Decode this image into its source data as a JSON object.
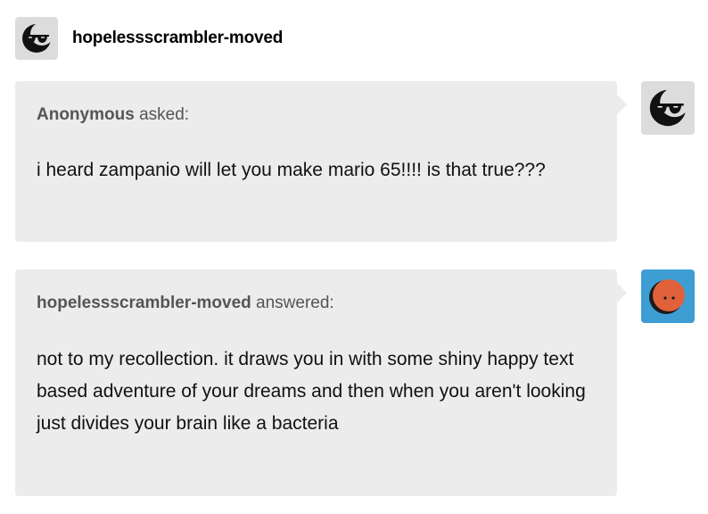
{
  "post": {
    "author": "hopelessscrambler-moved"
  },
  "ask": {
    "asker": "Anonymous",
    "verb": "asked:",
    "text": "i heard zampanio will let you make mario 65!!!! is that true???"
  },
  "answer": {
    "answerer": "hopelessscrambler-moved",
    "verb": "answered:",
    "text": "not to my recollection. it draws you in with some shiny happy text based adventure of your dreams and then when you aren't looking just divides your brain like a bac­teria"
  },
  "colors": {
    "bubble": "#ececec",
    "avatar_bg_gray": "#dcdcdc",
    "avatar_bg_blue": "#3e9ed3",
    "orange_face": "#e0613a"
  },
  "icons": {
    "header_avatar": "sunglasses-moon-icon",
    "anon_avatar": "sunglasses-moon-icon",
    "answer_avatar": "orange-face-icon"
  }
}
